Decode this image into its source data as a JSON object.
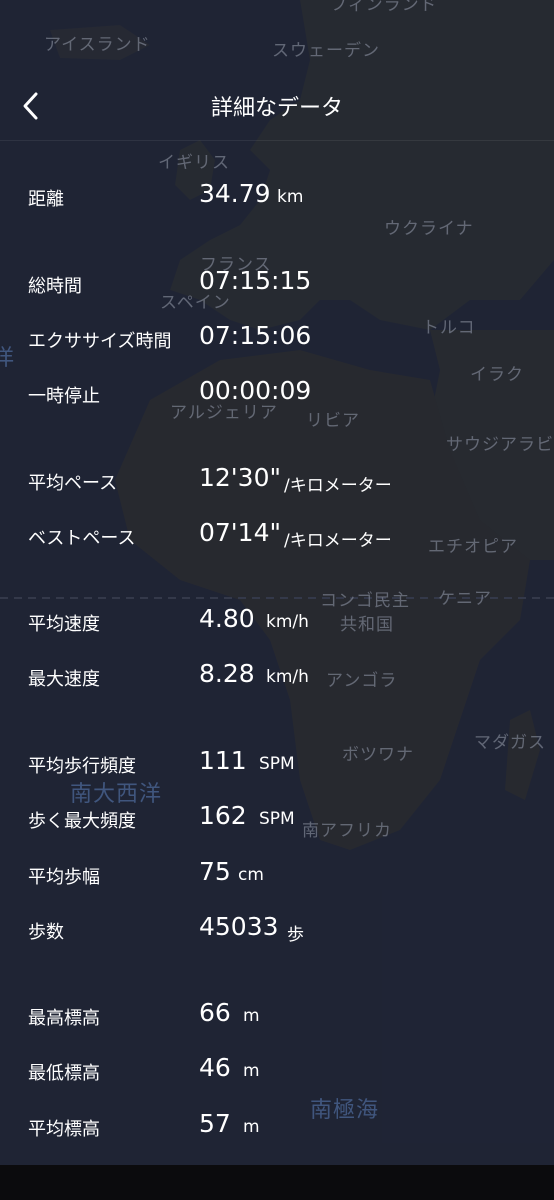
{
  "header": {
    "title": "詳細なデータ",
    "back_icon": "chevron-left-icon"
  },
  "map": {
    "labels": {
      "iceland": "アイスランド",
      "sweden": "スウェーデン",
      "finland": "フィンランド",
      "uk": "イギリス",
      "ukraine": "ウクライナ",
      "france": "フランス",
      "spain": "スペイン",
      "turkey": "トルコ",
      "ocean_left": "洋",
      "iraq": "イラク",
      "algeria": "アルジェリア",
      "libya": "リビア",
      "saudi": "サウジアラビ",
      "ethiopia": "エチオピア",
      "congo1": "コンゴ民主",
      "congo2": "共和国",
      "kenya": "ケニア",
      "angola": "アンゴラ",
      "madagascar": "マダガス",
      "botswana": "ボツワナ",
      "south_atlantic": "南大西洋",
      "south_africa": "南アフリカ",
      "southern_ocean": "南極海"
    }
  },
  "stats": {
    "distance": {
      "label": "距離",
      "value": "34.79",
      "unit": "km"
    },
    "total_time": {
      "label": "総時間",
      "value": "07:15:15"
    },
    "exercise_time": {
      "label": "エクササイズ時間",
      "value": "07:15:06"
    },
    "pause": {
      "label": "一時停止",
      "value": "00:00:09"
    },
    "avg_pace": {
      "label": "平均ペース",
      "value": "12'30\"",
      "unit": "/キロメーター"
    },
    "best_pace": {
      "label": "ベストペース",
      "value": "07'14\"",
      "unit": "/キロメーター"
    },
    "avg_speed": {
      "label": "平均速度",
      "value": "4.80",
      "unit": "km/h"
    },
    "max_speed": {
      "label": "最大速度",
      "value": "8.28",
      "unit": "km/h"
    },
    "avg_cadence": {
      "label": "平均歩行頻度",
      "value": "111",
      "unit": "SPM"
    },
    "max_cadence": {
      "label": "歩く最大頻度",
      "value": "162",
      "unit": "SPM"
    },
    "avg_stride": {
      "label": "平均歩幅",
      "value": "75",
      "unit": "cm"
    },
    "steps": {
      "label": "歩数",
      "value": "45033",
      "unit": "歩"
    },
    "max_altitude": {
      "label": "最高標高",
      "value": "66",
      "unit": "m"
    },
    "min_altitude": {
      "label": "最低標高",
      "value": "46",
      "unit": "m"
    },
    "avg_altitude": {
      "label": "平均標高",
      "value": "57",
      "unit": "m"
    }
  }
}
